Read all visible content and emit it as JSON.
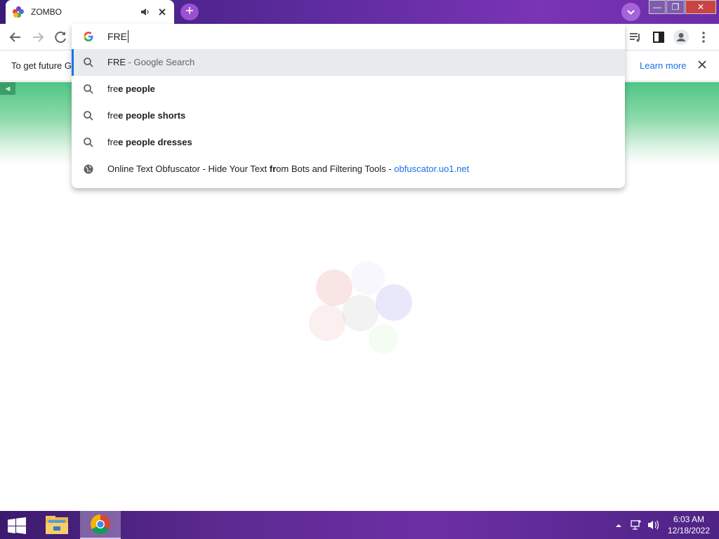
{
  "browser": {
    "tab": {
      "title": "ZOMBO",
      "audio_icon": "speaker-icon",
      "close_icon": "close-icon"
    },
    "new_tab_icon": "plus-icon",
    "tab_search_icon": "chevron-down-icon",
    "window_controls": {
      "minimize": "—",
      "maximize": "❐",
      "close": "✕"
    }
  },
  "toolbar": {
    "back_icon": "arrow-left-icon",
    "forward_icon": "arrow-right-icon",
    "reload_icon": "reload-icon",
    "media_icon": "media-control-icon",
    "side_panel_icon": "side-panel-icon",
    "profile_icon": "profile-icon",
    "menu_icon": "kebab-menu-icon"
  },
  "omnibox": {
    "value": "FRE",
    "suggestions": [
      {
        "type": "search",
        "icon": "search-icon",
        "prefix": "FRE",
        "bold": "",
        "desc": " - Google Search",
        "url": "",
        "selected": true
      },
      {
        "type": "search",
        "icon": "search-icon",
        "prefix": "fre",
        "bold": "e people",
        "desc": "",
        "url": "",
        "selected": false
      },
      {
        "type": "search",
        "icon": "search-icon",
        "prefix": "fre",
        "bold": "e people shorts",
        "desc": "",
        "url": "",
        "selected": false
      },
      {
        "type": "search",
        "icon": "search-icon",
        "prefix": "fre",
        "bold": "e people dresses",
        "desc": "",
        "url": "",
        "selected": false
      },
      {
        "type": "history",
        "icon": "globe-icon",
        "prefix": "Online Text Obfuscator - Hide Your Text ",
        "bold": "fr",
        "desc": "om Bots and Filtering Tools - ",
        "url": "obfuscator.uo1.net",
        "selected": false
      }
    ]
  },
  "infobar": {
    "text": "To get future G",
    "learn_more": "Learn more",
    "close_icon": "close-icon"
  },
  "taskbar": {
    "time": "6:03 AM",
    "date": "12/18/2022",
    "tray_icons": [
      "chevron-up-icon",
      "network-icon",
      "volume-icon"
    ]
  },
  "colors": {
    "title_purple": "#5a2a9b",
    "accent_blue": "#1a73e8",
    "page_green": "#4fc584",
    "selected_row": "#e8eaed"
  }
}
